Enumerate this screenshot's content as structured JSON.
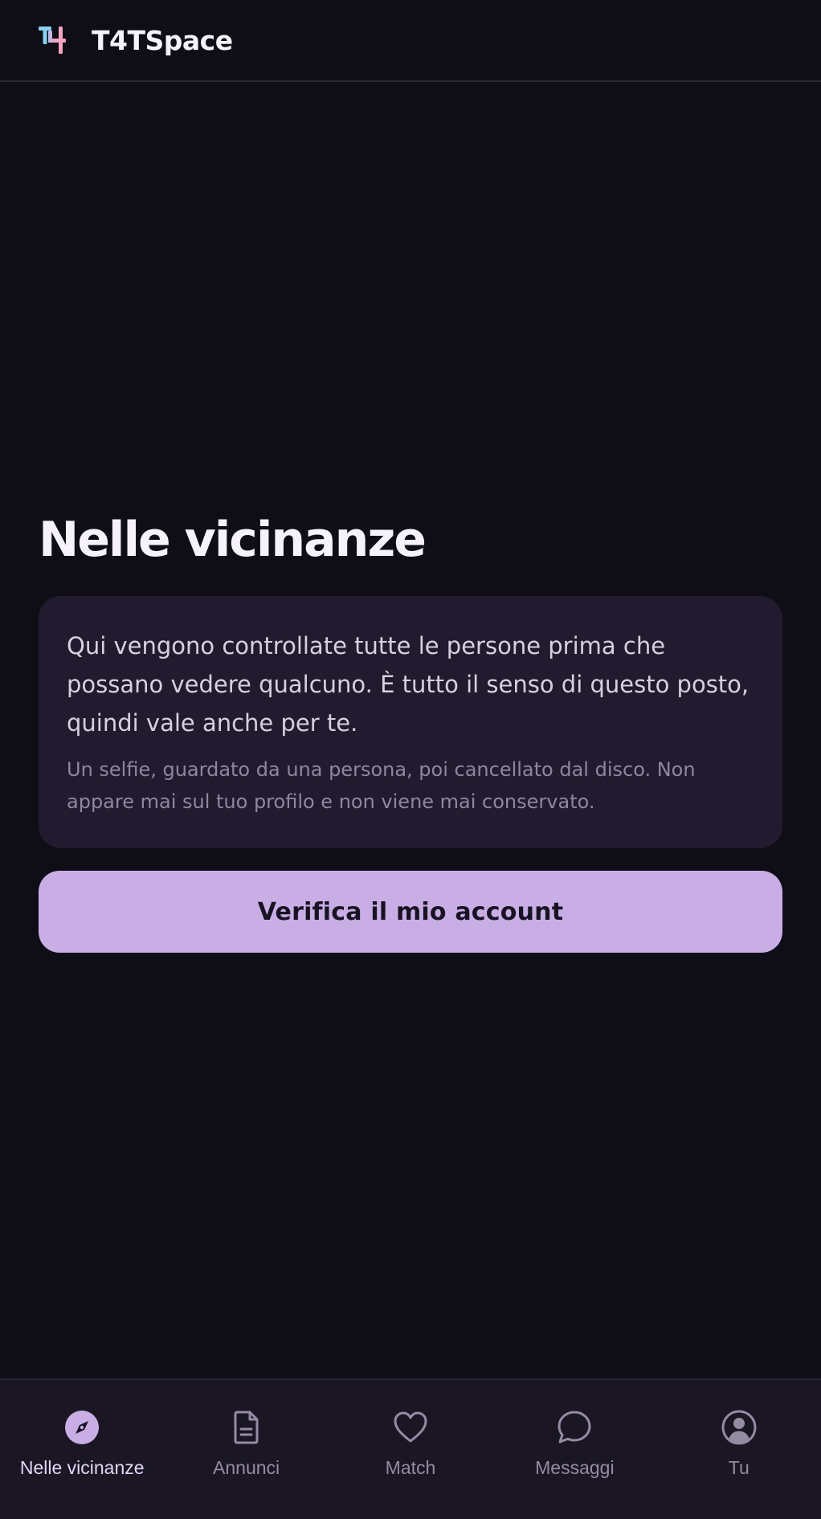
{
  "header": {
    "brand": "T4TSpace",
    "logo_icon": "t4-logo-icon"
  },
  "main": {
    "title": "Nelle vicinanze",
    "card": {
      "lead": "Qui vengono controllate tutte le persone prima che possano vedere qualcuno. È tutto il senso di questo posto, quindi vale anche per te.",
      "sub": "Un selfie, guardato da una persona, poi cancellato dal disco. Non appare mai sul tuo profilo e non viene mai conservato."
    },
    "verify_button": "Verifica il mio account"
  },
  "nav": {
    "items": [
      {
        "label": "Nelle vicinanze",
        "icon": "compass-icon",
        "active": true
      },
      {
        "label": "Annunci",
        "icon": "document-icon",
        "active": false
      },
      {
        "label": "Match",
        "icon": "heart-icon",
        "active": false
      },
      {
        "label": "Messaggi",
        "icon": "chat-bubble-icon",
        "active": false
      },
      {
        "label": "Tu",
        "icon": "user-circle-icon",
        "active": false
      }
    ]
  },
  "colors": {
    "background": "#0f0d16",
    "card": "#221b2f",
    "accent": "#c9aee6",
    "nav_background": "#1a1624",
    "logo_blue": "#8ad0f2",
    "logo_pink": "#f2a4c0"
  }
}
